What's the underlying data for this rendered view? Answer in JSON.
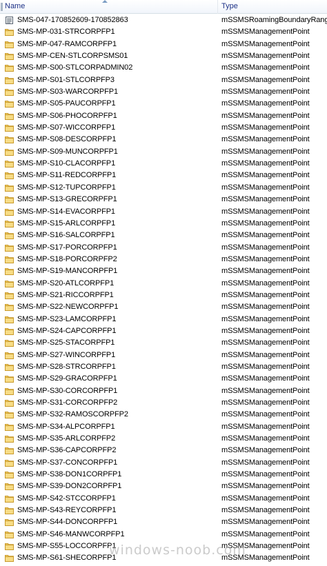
{
  "columns": {
    "name": "Name",
    "type": "Type"
  },
  "watermark": "windows-noob.com",
  "rows": [
    {
      "name": "SMS-047-170852609-170852863",
      "type": "mSSMSRoamingBoundaryRange",
      "icon": "document-icon"
    },
    {
      "name": "SMS-MP-031-STRCORPFP1",
      "type": "mSSMSManagementPoint",
      "icon": "folder-icon"
    },
    {
      "name": "SMS-MP-047-RAMCORPFP1",
      "type": "mSSMSManagementPoint",
      "icon": "folder-icon"
    },
    {
      "name": "SMS-MP-CEN-STLCORPSMS01",
      "type": "mSSMSManagementPoint",
      "icon": "folder-icon"
    },
    {
      "name": "SMS-MP-S00-STLCORPADMIN02",
      "type": "mSSMSManagementPoint",
      "icon": "folder-icon"
    },
    {
      "name": "SMS-MP-S01-STLCORPFP3",
      "type": "mSSMSManagementPoint",
      "icon": "folder-icon"
    },
    {
      "name": "SMS-MP-S03-WARCORPFP1",
      "type": "mSSMSManagementPoint",
      "icon": "folder-icon"
    },
    {
      "name": "SMS-MP-S05-PAUCORPFP1",
      "type": "mSSMSManagementPoint",
      "icon": "folder-icon"
    },
    {
      "name": "SMS-MP-S06-PHOCORPFP1",
      "type": "mSSMSManagementPoint",
      "icon": "folder-icon"
    },
    {
      "name": "SMS-MP-S07-WICCORPFP1",
      "type": "mSSMSManagementPoint",
      "icon": "folder-icon"
    },
    {
      "name": "SMS-MP-S08-DESCORPFP1",
      "type": "mSSMSManagementPoint",
      "icon": "folder-icon"
    },
    {
      "name": "SMS-MP-S09-MUNCORPFP1",
      "type": "mSSMSManagementPoint",
      "icon": "folder-icon"
    },
    {
      "name": "SMS-MP-S10-CLACORPFP1",
      "type": "mSSMSManagementPoint",
      "icon": "folder-icon"
    },
    {
      "name": "SMS-MP-S11-REDCORPFP1",
      "type": "mSSMSManagementPoint",
      "icon": "folder-icon"
    },
    {
      "name": "SMS-MP-S12-TUPCORPFP1",
      "type": "mSSMSManagementPoint",
      "icon": "folder-icon"
    },
    {
      "name": "SMS-MP-S13-GRECORPFP1",
      "type": "mSSMSManagementPoint",
      "icon": "folder-icon"
    },
    {
      "name": "SMS-MP-S14-EVACORPFP1",
      "type": "mSSMSManagementPoint",
      "icon": "folder-icon"
    },
    {
      "name": "SMS-MP-S15-ARLCORPFP1",
      "type": "mSSMSManagementPoint",
      "icon": "folder-icon"
    },
    {
      "name": "SMS-MP-S16-SALCORPFP1",
      "type": "mSSMSManagementPoint",
      "icon": "folder-icon"
    },
    {
      "name": "SMS-MP-S17-PORCORPFP1",
      "type": "mSSMSManagementPoint",
      "icon": "folder-icon"
    },
    {
      "name": "SMS-MP-S18-PORCORPFP2",
      "type": "mSSMSManagementPoint",
      "icon": "folder-icon"
    },
    {
      "name": "SMS-MP-S19-MANCORPFP1",
      "type": "mSSMSManagementPoint",
      "icon": "folder-icon"
    },
    {
      "name": "SMS-MP-S20-ATLCORPFP1",
      "type": "mSSMSManagementPoint",
      "icon": "folder-icon"
    },
    {
      "name": "SMS-MP-S21-RICCORPFP1",
      "type": "mSSMSManagementPoint",
      "icon": "folder-icon"
    },
    {
      "name": "SMS-MP-S22-NEWCORPFP1",
      "type": "mSSMSManagementPoint",
      "icon": "folder-icon"
    },
    {
      "name": "SMS-MP-S23-LAMCORPFP1",
      "type": "mSSMSManagementPoint",
      "icon": "folder-icon"
    },
    {
      "name": "SMS-MP-S24-CAPCORPFP1",
      "type": "mSSMSManagementPoint",
      "icon": "folder-icon"
    },
    {
      "name": "SMS-MP-S25-STACORPFP1",
      "type": "mSSMSManagementPoint",
      "icon": "folder-icon"
    },
    {
      "name": "SMS-MP-S27-WINCORPFP1",
      "type": "mSSMSManagementPoint",
      "icon": "folder-icon"
    },
    {
      "name": "SMS-MP-S28-STRCORPFP1",
      "type": "mSSMSManagementPoint",
      "icon": "folder-icon"
    },
    {
      "name": "SMS-MP-S29-GRACORPFP1",
      "type": "mSSMSManagementPoint",
      "icon": "folder-icon"
    },
    {
      "name": "SMS-MP-S30-CORCORPFP1",
      "type": "mSSMSManagementPoint",
      "icon": "folder-icon"
    },
    {
      "name": "SMS-MP-S31-CORCORPFP2",
      "type": "mSSMSManagementPoint",
      "icon": "folder-icon"
    },
    {
      "name": "SMS-MP-S32-RAMOSCORPFP2",
      "type": "mSSMSManagementPoint",
      "icon": "folder-icon"
    },
    {
      "name": "SMS-MP-S34-ALPCORPFP1",
      "type": "mSSMSManagementPoint",
      "icon": "folder-icon"
    },
    {
      "name": "SMS-MP-S35-ARLCORPFP2",
      "type": "mSSMSManagementPoint",
      "icon": "folder-icon"
    },
    {
      "name": "SMS-MP-S36-CAPCORPFP2",
      "type": "mSSMSManagementPoint",
      "icon": "folder-icon"
    },
    {
      "name": "SMS-MP-S37-CONCORPFP1",
      "type": "mSSMSManagementPoint",
      "icon": "folder-icon"
    },
    {
      "name": "SMS-MP-S38-DON1CORPFP1",
      "type": "mSSMSManagementPoint",
      "icon": "folder-icon"
    },
    {
      "name": "SMS-MP-S39-DON2CORPFP1",
      "type": "mSSMSManagementPoint",
      "icon": "folder-icon"
    },
    {
      "name": "SMS-MP-S42-STCCORPFP1",
      "type": "mSSMSManagementPoint",
      "icon": "folder-icon"
    },
    {
      "name": "SMS-MP-S43-REYCORPFP1",
      "type": "mSSMSManagementPoint",
      "icon": "folder-icon"
    },
    {
      "name": "SMS-MP-S44-DONCORPFP1",
      "type": "mSSMSManagementPoint",
      "icon": "folder-icon"
    },
    {
      "name": "SMS-MP-S46-MANWCORPFP1",
      "type": "mSSMSManagementPoint",
      "icon": "folder-icon"
    },
    {
      "name": "SMS-MP-S55-LOCCORPFP1",
      "type": "mSSMSManagementPoint",
      "icon": "folder-icon"
    },
    {
      "name": "SMS-MP-S61-SHECORPFP1",
      "type": "mSSMSManagementPoint",
      "icon": "folder-icon"
    }
  ]
}
